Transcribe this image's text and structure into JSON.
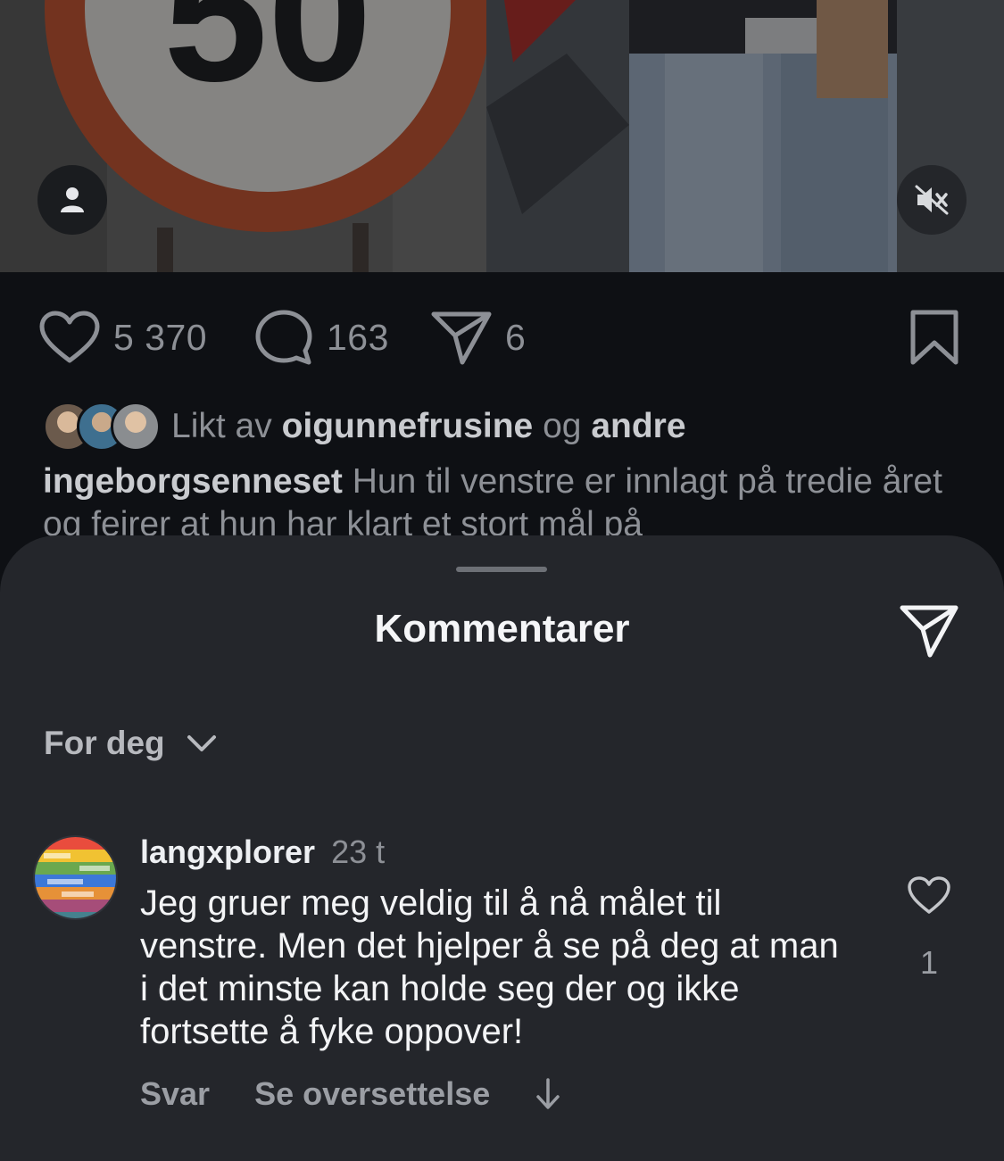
{
  "post": {
    "stats": {
      "likes": "5 370",
      "comments": "163",
      "shares": "6"
    },
    "liked_by": {
      "prefix": "Likt av",
      "user": "oigunnefrusine",
      "joiner": "og",
      "others": "andre"
    },
    "caption": {
      "author": "ingeborgsenneset",
      "text": "Hun til venstre er innlagt på tredie året og feirer at hun har klart et stort mål på"
    }
  },
  "media": {
    "left_sign_number": "50"
  },
  "comments_sheet": {
    "title": "Kommentarer",
    "sort_label": "For deg",
    "comment": {
      "username": "langxplorer",
      "time": "23 t",
      "text": "Jeg gruer meg veldig til å nå målet til venstre. Men det hjelper å se på deg at man i det minste kan holde seg der og ikke fortsette å fyke oppover!",
      "like_count": "1",
      "reply_label": "Svar",
      "translate_label": "Se oversettelse"
    }
  },
  "icons": {
    "user_tag": "user-tag-icon",
    "mute": "speaker-muted-icon",
    "like": "heart-icon",
    "comment": "comment-bubble-icon",
    "share": "paper-plane-icon",
    "save": "bookmark-icon",
    "sort": "chevron-down-icon",
    "more": "arrow-down-icon"
  },
  "colors": {
    "sheet_bg": "#24262b",
    "post_bg": "#0e1014",
    "muted_text": "#8d9096",
    "sign_red": "#d2552a"
  }
}
